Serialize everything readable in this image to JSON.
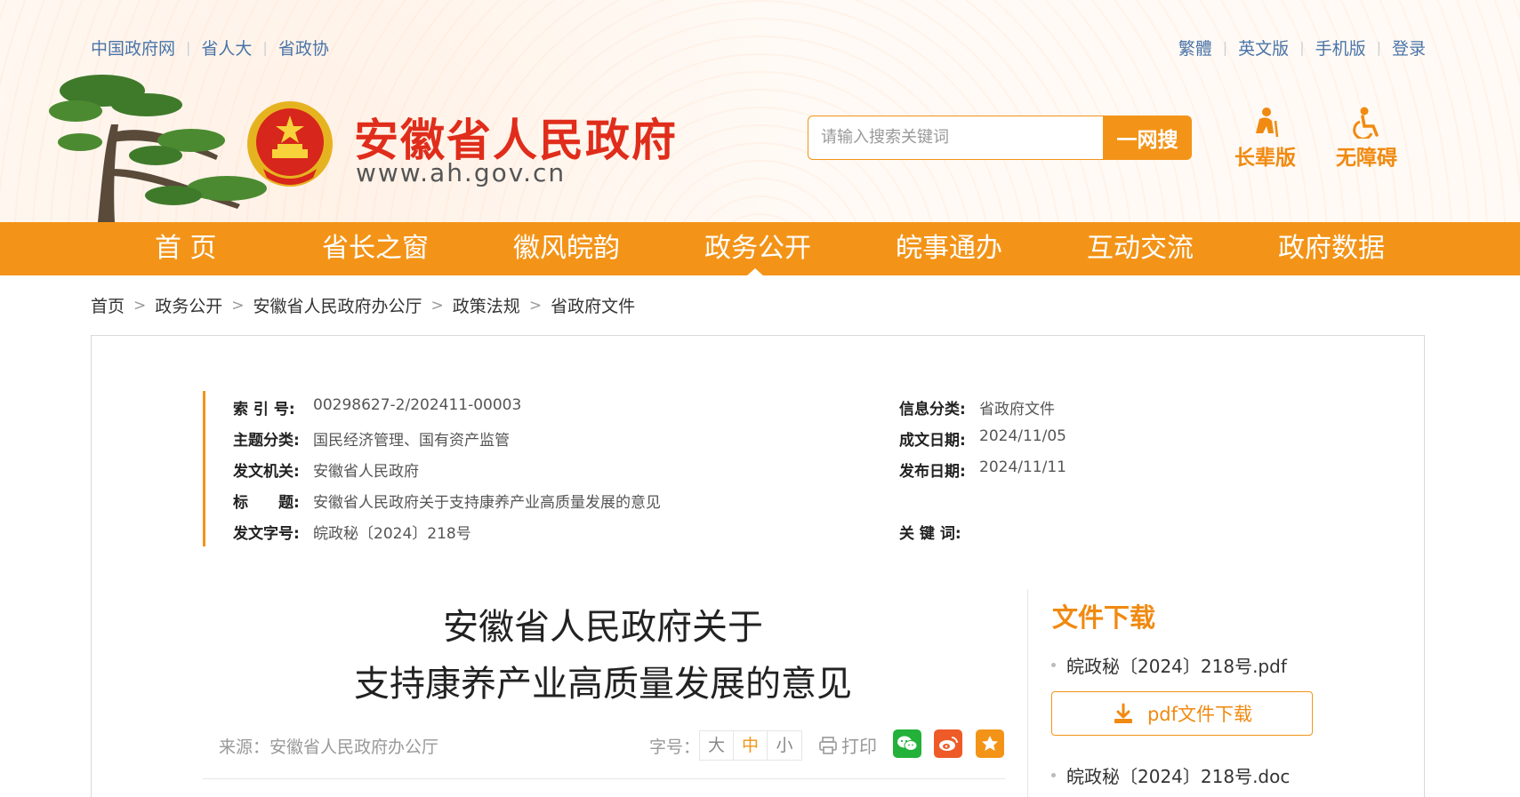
{
  "top_links": {
    "left": [
      "中国政府网",
      "省人大",
      "省政协"
    ],
    "right": [
      "繁體",
      "英文版",
      "手机版",
      "登录"
    ]
  },
  "site": {
    "title": "安徽省人民政府",
    "url": "www.ah.gov.cn"
  },
  "search": {
    "placeholder": "请输入搜索关键词",
    "button": "一网搜"
  },
  "modes": {
    "elder": "长辈版",
    "accessible": "无障碍"
  },
  "nav": [
    "首 页",
    "省长之窗",
    "徽风皖韵",
    "政务公开",
    "皖事通办",
    "互动交流",
    "政府数据"
  ],
  "breadcrumb": [
    "首页",
    "政务公开",
    "安徽省人民政府办公厅",
    "政策法规",
    "省政府文件"
  ],
  "meta": {
    "index_label": "索 引 号:",
    "index_value": "00298627-2/202411-00003",
    "category_label": "信息分类:",
    "category_value": "省政府文件",
    "topic_label": "主题分类:",
    "topic_value": "国民经济管理、国有资产监管",
    "created_label": "成文日期:",
    "created_value": "2024/11/05",
    "issuer_label": "发文机关:",
    "issuer_value": "安徽省人民政府",
    "published_label": "发布日期:",
    "published_value": "2024/11/11",
    "title_label": "标　　题:",
    "title_value": "安徽省人民政府关于支持康养产业高质量发展的意见",
    "docno_label": "发文字号:",
    "docno_value": "皖政秘〔2024〕218号",
    "keywords_label": "关 键 词:",
    "keywords_value": ""
  },
  "article": {
    "title_line1": "安徽省人民政府关于",
    "title_line2": "支持康养产业高质量发展的意见",
    "source": "来源：安徽省人民政府办公厅",
    "font_size_label": "字号：",
    "font_sizes": [
      "大",
      "中",
      "小"
    ],
    "print": "打印"
  },
  "downloads": {
    "title": "文件下载",
    "pdf_name": "皖政秘〔2024〕218号.pdf",
    "pdf_button": "pdf文件下载",
    "doc_name": "皖政秘〔2024〕218号.doc"
  },
  "colors": {
    "accent": "#f39418",
    "title_red": "#e02d1b",
    "link_blue": "#4a74a8"
  }
}
